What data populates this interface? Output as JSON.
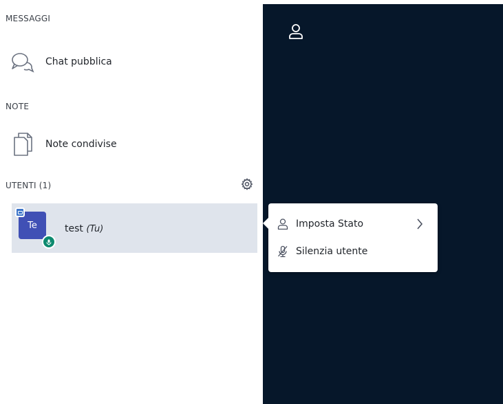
{
  "sections": {
    "messages_title": "MESSAGGI",
    "notes_title": "NOTE",
    "users_title": "UTENTI (1)"
  },
  "nav": {
    "public_chat": "Chat pubblica",
    "shared_notes": "Note condivise"
  },
  "user": {
    "initials": "Te",
    "name": "test",
    "self_tag": "(Tu)"
  },
  "menu": {
    "set_status": "Imposta Stato",
    "mute_user": "Silenzia utente"
  },
  "icons": {
    "chat": "chat-bubbles-icon",
    "notes": "documents-icon",
    "settings": "gear-icon",
    "user": "user-icon",
    "mic": "microphone-icon",
    "mic_muted": "microphone-muted-icon",
    "chevron": "chevron-right-icon"
  },
  "colors": {
    "main_bg": "#06172a",
    "avatar_bg": "#4050b5",
    "user_row_bg": "#dfe4ec",
    "presenter_badge": "#3a73c9",
    "voice_badge": "#0d8a6f"
  }
}
